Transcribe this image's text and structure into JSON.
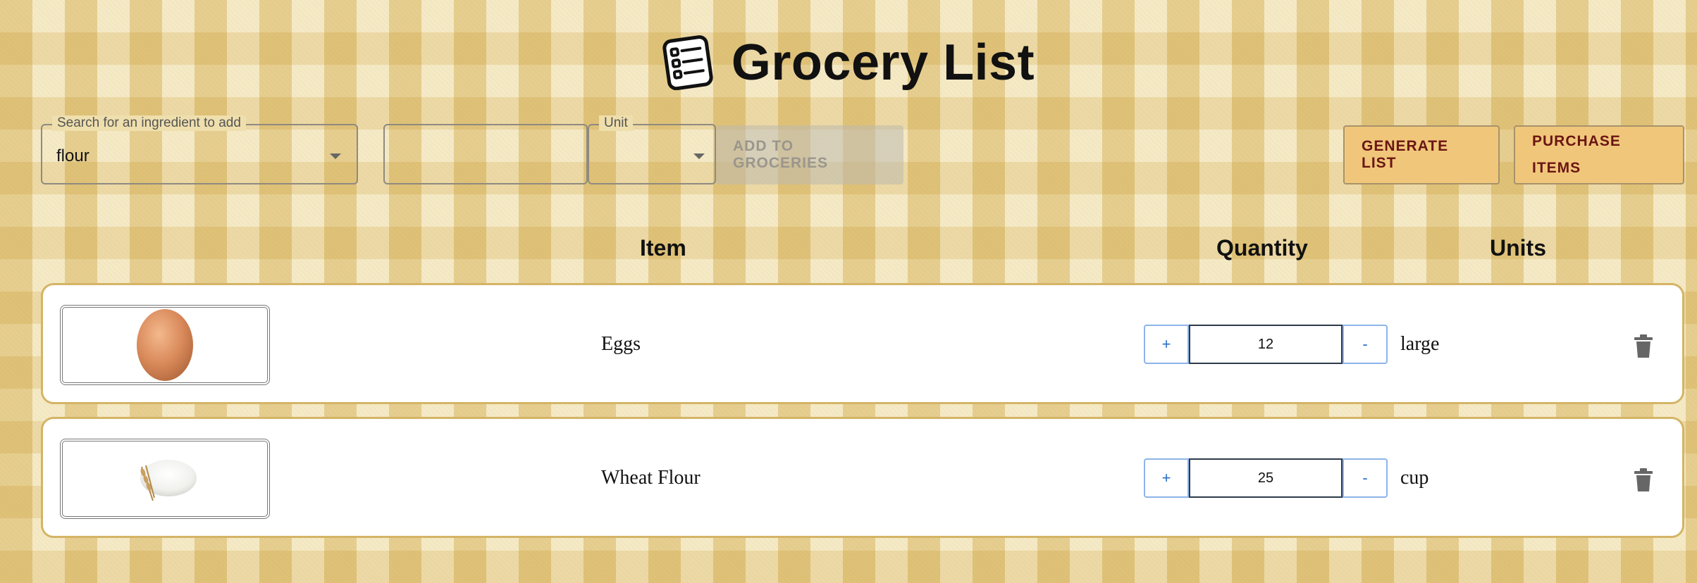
{
  "header": {
    "title": "Grocery List",
    "icon": "checklist-icon"
  },
  "toolbar": {
    "search": {
      "label": "Search for an ingredient to add",
      "value": "flour"
    },
    "quantity": {
      "value": ""
    },
    "unit": {
      "label": "Unit",
      "value": ""
    },
    "add_button": "ADD TO GROCERIES",
    "generate_button": "GENERATE LIST",
    "purchase_button_line1": "PURCHASE",
    "purchase_button_line2": "ITEMS"
  },
  "columns": {
    "item": "Item",
    "quantity": "Quantity",
    "units": "Units"
  },
  "items": [
    {
      "name": "Eggs",
      "quantity": "12",
      "unit": "large",
      "image": "egg-image",
      "plus": "+",
      "minus": "-"
    },
    {
      "name": "Wheat Flour",
      "quantity": "25",
      "unit": "cup",
      "image": "flour-image",
      "plus": "+",
      "minus": "-"
    }
  ],
  "colors": {
    "accent_button": "#f0c77a",
    "accent_text": "#6b1514",
    "row_border": "#d4b466",
    "stepper_blue": "#2a6fc9"
  }
}
